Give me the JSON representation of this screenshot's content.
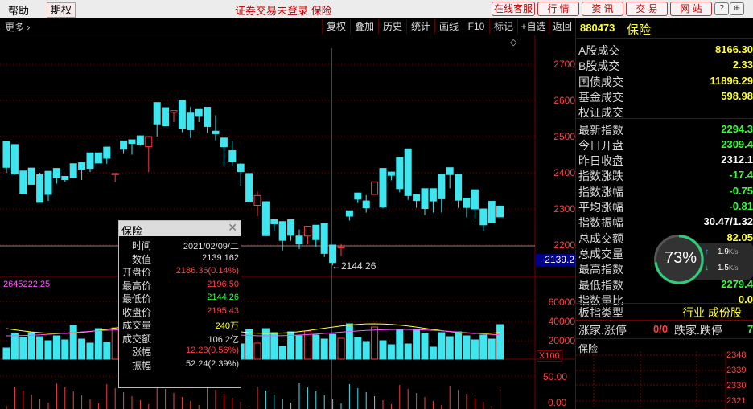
{
  "topbar": {
    "help": "帮助",
    "futures": "期权",
    "status": "证券交易未登录  保险",
    "buttons": [
      "在线客服",
      "行 情",
      "资 讯",
      "交 易",
      "网 站"
    ],
    "win_buttons": [
      "?",
      "⊕"
    ]
  },
  "toolbar": {
    "more": "更多 ›",
    "items": [
      "复权",
      "叠加",
      "历史",
      "统计",
      "画线",
      "F10",
      "标记",
      "+自选",
      "返回"
    ]
  },
  "chart": {
    "price_axis": [
      "2700",
      "2600",
      "2500",
      "2400",
      "2300",
      "2200"
    ],
    "crosshair_price": "2139.2",
    "crosshair_label": "2144.26",
    "volume_total": "2645222.25",
    "volume_axis": [
      "60000",
      "40000",
      "20000"
    ],
    "volume_unit": "X100",
    "lower_axis": "50.00",
    "lower_axis2": "0.00"
  },
  "chart_data": {
    "type": "candlestick",
    "candles": [
      [
        2467,
        2487,
        2415,
        2400
      ],
      [
        2432,
        2478,
        2397,
        2395
      ],
      [
        2395,
        2405,
        2342,
        2385
      ],
      [
        2383,
        2413,
        2368,
        2376
      ],
      [
        2400,
        2395,
        2318,
        2361
      ],
      [
        2356,
        2404,
        2340,
        2322
      ],
      [
        2387,
        2412,
        2386,
        2370
      ],
      [
        2376,
        2390,
        2381,
        2375
      ],
      [
        2390,
        2425,
        2386,
        2388
      ],
      [
        2398,
        2428,
        2410,
        2380
      ],
      [
        2416,
        2455,
        2412,
        2402
      ],
      [
        2450,
        2455,
        2427,
        2447
      ],
      [
        2432,
        2471,
        2440,
        2425
      ],
      [
        2374,
        2395,
        2398,
        2374
      ],
      [
        2458,
        2488,
        2465,
        2452
      ],
      [
        2452,
        2491,
        2481,
        2450
      ],
      [
        2495,
        2502,
        2478,
        2475
      ],
      [
        2403,
        2472,
        2500,
        2402
      ],
      [
        2575,
        2594,
        2535,
        2500
      ],
      [
        2532,
        2580,
        2530,
        2540
      ],
      [
        2551,
        2567,
        2572,
        2540
      ],
      [
        2545,
        2600,
        2523,
        2512
      ],
      [
        2582,
        2565,
        2519,
        2496
      ],
      [
        2550,
        2575,
        2558,
        2540
      ],
      [
        2577,
        2581,
        2528,
        2510
      ],
      [
        2559,
        2515,
        2508,
        2490
      ],
      [
        2437,
        2496,
        2472,
        2420
      ],
      [
        2489,
        2461,
        2430,
        2420
      ],
      [
        2427,
        2424,
        2403,
        2364
      ],
      [
        2373,
        2398,
        2319,
        2345
      ],
      [
        2348,
        2310,
        2337,
        2280
      ],
      [
        2307,
        2320,
        2226,
        2226
      ],
      [
        2238,
        2270,
        2259,
        2260
      ],
      [
        2250,
        2265,
        2213,
        2185
      ],
      [
        2258,
        2270,
        2227,
        2212
      ],
      [
        2243,
        2225,
        2203,
        2189
      ],
      [
        2212,
        2225,
        2252,
        2202
      ],
      [
        2240,
        2255,
        2215,
        2195
      ],
      [
        2220,
        2259,
        2177,
        2167
      ],
      [
        2185,
        2200,
        2152,
        2144
      ],
      [
        2203,
        2192,
        2195,
        2170
      ],
      [
        2284,
        2295,
        2280,
        2268
      ],
      [
        2329,
        2344,
        2327,
        2316
      ],
      [
        2338,
        2322,
        2303,
        2290
      ],
      [
        2355,
        2340,
        2375,
        2341
      ],
      [
        2330,
        2412,
        2305,
        2302
      ],
      [
        2391,
        2402,
        2393,
        2379
      ],
      [
        2350,
        2442,
        2356,
        2346
      ],
      [
        2453,
        2466,
        2337,
        2325
      ],
      [
        2336,
        2340,
        2323,
        2303
      ],
      [
        2330,
        2356,
        2301,
        2283
      ],
      [
        2340,
        2356,
        2322,
        2290
      ],
      [
        2382,
        2396,
        2328,
        2290
      ],
      [
        2369,
        2414,
        2395,
        2357
      ],
      [
        2356,
        2396,
        2324,
        2303
      ],
      [
        2320,
        2330,
        2304,
        2277
      ],
      [
        2334,
        2353,
        2300,
        2272
      ],
      [
        2294,
        2300,
        2256,
        2240
      ],
      [
        2311,
        2321,
        2262,
        2264
      ],
      [
        2294,
        2308,
        2278,
        2277
      ]
    ],
    "crosshair_date": "2021/02/09/二"
  },
  "tooltip": {
    "title": "保险",
    "rows": [
      {
        "label": "时间",
        "value": "2021/02/09/二",
        "color": "#dddddd"
      },
      {
        "label": "数值",
        "value": "2139.162",
        "color": "#dddddd"
      },
      {
        "label": "开盘价",
        "value": "2186.36(0.14%)",
        "color": "#ff4040"
      },
      {
        "label": "最高价",
        "value": "2196.50",
        "color": "#ff4040"
      },
      {
        "label": "最低价",
        "value": "2144.26",
        "color": "#33ff33"
      },
      {
        "label": "收盘价",
        "value": "2195.43",
        "color": "#ff4040"
      },
      {
        "label": "成交量",
        "value": "240万",
        "color": "#ffff33"
      },
      {
        "label": "成交额",
        "value": "106.2亿",
        "color": "#dddddd"
      },
      {
        "label": "涨幅",
        "value": "12.23(0.56%)",
        "color": "#ff4040"
      },
      {
        "label": "振幅",
        "value": "52.24(2.39%)",
        "color": "#dddddd"
      }
    ]
  },
  "right_panel": {
    "code": "880473",
    "name": "保险",
    "rows": [
      {
        "label": "A股成交",
        "value": "8166.30",
        "color": "yellow"
      },
      {
        "label": "B股成交",
        "value": "2.33",
        "color": "yellow"
      },
      {
        "label": "国债成交",
        "value": "11896.29",
        "color": "yellow"
      },
      {
        "label": "基金成交",
        "value": "598.98",
        "color": "yellow"
      },
      {
        "label": "权证成交",
        "value": "",
        "color": "yellow"
      },
      {
        "label": "最新指数",
        "value": "2294.3",
        "color": "green"
      },
      {
        "label": "今日开盘",
        "value": "2309.4",
        "color": "green"
      },
      {
        "label": "昨日收盘",
        "value": "2312.1",
        "color": "white"
      },
      {
        "label": "指数涨跌",
        "value": "-17.4",
        "color": "green"
      },
      {
        "label": "指数涨幅",
        "value": "-0.75",
        "color": "green"
      },
      {
        "label": "平均涨幅",
        "value": "-0.81",
        "color": "green"
      },
      {
        "label": "指数振幅",
        "value": "30.47/1.32",
        "color": "white"
      },
      {
        "label": "总成交额",
        "value": "82.05",
        "color": "yellow"
      },
      {
        "label": "总成交量",
        "value": "",
        "color": "yellow"
      },
      {
        "label": "最高指数",
        "value": "",
        "color": "red"
      },
      {
        "label": "最低指数",
        "value": "2279.4",
        "color": "green"
      },
      {
        "label": "指数量比",
        "value": "0.0",
        "color": "yellow"
      }
    ],
    "sector_label": "板指类型",
    "sector_value": "行业 成份股",
    "updown_label": "涨家.涨停",
    "updown_value": "0/0",
    "down_label": "跌家.跌停",
    "down_value": "7",
    "mini_title": "保险",
    "mini_axis": [
      "2348",
      "2339",
      "2330",
      "2321"
    ]
  },
  "gauge": {
    "percent": "73%",
    "up_speed": "1.9",
    "down_speed": "1.5",
    "unit": "K/s"
  }
}
